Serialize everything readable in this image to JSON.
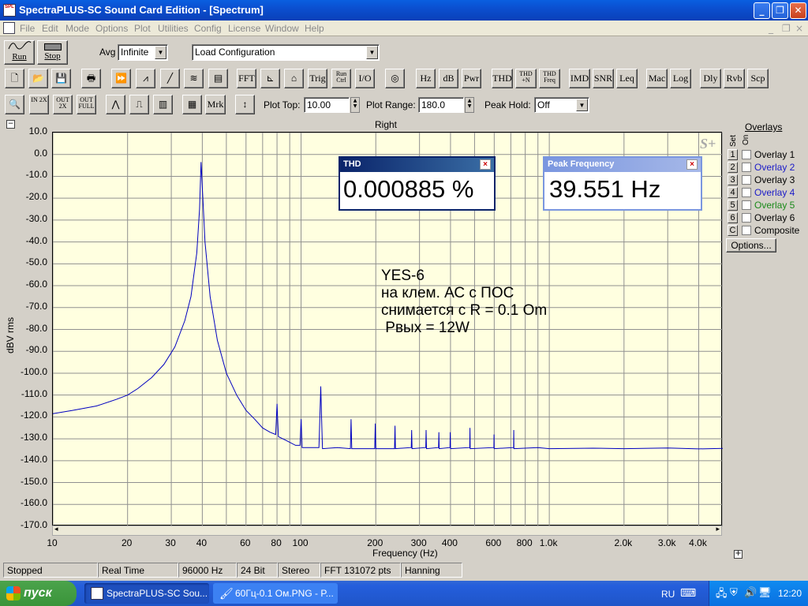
{
  "window": {
    "title": "SpectraPLUS-SC Sound Card Edition - [Spectrum]",
    "minimize": "_",
    "restore": "❐",
    "close": "✕"
  },
  "menu": [
    "File",
    "Edit",
    "Mode",
    "Options",
    "Plot",
    "Utilities",
    "Config",
    "License",
    "Window",
    "Help"
  ],
  "mdi_controls": {
    "minimize": "_",
    "restore": "❐",
    "close": "×"
  },
  "toolbar1": {
    "run": "Run",
    "stop": "Stop",
    "avg_label": "Avg",
    "avg_value": "Infinite",
    "config_value": "Load Configuration"
  },
  "toolbar2": [
    "FFT",
    "Trig",
    "Run Ctrl",
    "I/O",
    "Hz",
    "dB",
    "Pwr",
    "THD",
    "THD +N",
    "THD Freq",
    "IMD",
    "SNR",
    "Leq",
    "Mac",
    "Log",
    "Dly",
    "Rvb",
    "Scp"
  ],
  "toolbar3": {
    "zoom_in": "IN 2X",
    "zoom_out": "OUT 2X",
    "zoom_full": "OUT FULL",
    "mrk": "Mrk",
    "plot_top_label": "Plot Top:",
    "plot_top_value": "10.00",
    "plot_range_label": "Plot Range:",
    "plot_range_value": "180.0",
    "peak_hold_label": "Peak Hold:",
    "peak_hold_value": "Off"
  },
  "chart_data": {
    "type": "line",
    "title": "Right",
    "xlabel": "Frequency (Hz)",
    "ylabel": "dBV rms",
    "xscale": "log",
    "xlim": [
      10,
      5000
    ],
    "ylim": [
      -170,
      10
    ],
    "yticks": [
      "10.0",
      "0.0",
      "-10.0",
      "-20.0",
      "-30.0",
      "-40.0",
      "-50.0",
      "-60.0",
      "-70.0",
      "-80.0",
      "-90.0",
      "-100.0",
      "-110.0",
      "-120.0",
      "-130.0",
      "-140.0",
      "-150.0",
      "-160.0",
      "-170.0"
    ],
    "xticks": [
      "10",
      "20",
      "30",
      "40",
      "60",
      "80",
      "100",
      "200",
      "300",
      "400",
      "600",
      "800",
      "1.0k",
      "2.0k",
      "3.0k",
      "4.0k"
    ],
    "grid": true,
    "series": [
      {
        "color": "#0000c0",
        "points": [
          [
            10,
            -118.5
          ],
          [
            12,
            -117
          ],
          [
            15,
            -115
          ],
          [
            18,
            -112
          ],
          [
            20,
            -110
          ],
          [
            22,
            -107
          ],
          [
            25,
            -102
          ],
          [
            28,
            -96
          ],
          [
            31,
            -88
          ],
          [
            34,
            -76
          ],
          [
            36,
            -65
          ],
          [
            38,
            -45
          ],
          [
            39,
            -25
          ],
          [
            39.55,
            -3.5
          ],
          [
            40.2,
            -20
          ],
          [
            41,
            -40
          ],
          [
            43,
            -65
          ],
          [
            46,
            -85
          ],
          [
            50,
            -100
          ],
          [
            55,
            -110
          ],
          [
            60,
            -117
          ],
          [
            65,
            -121
          ],
          [
            70,
            -125
          ],
          [
            75,
            -127
          ],
          [
            79,
            -128
          ],
          [
            80,
            -114
          ],
          [
            81,
            -129
          ],
          [
            88,
            -131
          ],
          [
            95,
            -133
          ],
          [
            99,
            -133
          ],
          [
            100,
            -121
          ],
          [
            101,
            -134
          ],
          [
            110,
            -134
          ],
          [
            118,
            -134
          ],
          [
            119,
            -121
          ],
          [
            120,
            -106
          ],
          [
            121,
            -121
          ],
          [
            122,
            -134.5
          ],
          [
            140,
            -134
          ],
          [
            158,
            -134.5
          ],
          [
            159,
            -121
          ],
          [
            160,
            -134.5
          ],
          [
            198,
            -134.5
          ],
          [
            199,
            -123
          ],
          [
            200,
            -134.5
          ],
          [
            238,
            -134.5
          ],
          [
            239,
            -124
          ],
          [
            240,
            -134.5
          ],
          [
            278,
            -134
          ],
          [
            279,
            -126
          ],
          [
            280,
            -134.5
          ],
          [
            318,
            -134
          ],
          [
            319,
            -126
          ],
          [
            320,
            -134.5
          ],
          [
            358,
            -134
          ],
          [
            359,
            -127
          ],
          [
            360,
            -134.5
          ],
          [
            398,
            -134
          ],
          [
            399,
            -127
          ],
          [
            400,
            -134.5
          ],
          [
            478,
            -134
          ],
          [
            479,
            -125
          ],
          [
            480,
            -134.5
          ],
          [
            598,
            -134
          ],
          [
            599,
            -128
          ],
          [
            600,
            -134.5
          ],
          [
            718,
            -134
          ],
          [
            719,
            -126
          ],
          [
            720,
            -134.5
          ],
          [
            900,
            -134
          ],
          [
            1000,
            -134.5
          ],
          [
            1500,
            -134.3
          ],
          [
            2000,
            -134.5
          ],
          [
            3000,
            -134.2
          ],
          [
            4000,
            -134.6
          ],
          [
            5000,
            -134.4
          ]
        ]
      }
    ]
  },
  "thd_window": {
    "title": "THD",
    "value": "0.000885 %"
  },
  "peak_window": {
    "title": "Peak Frequency",
    "value": "39.551 Hz"
  },
  "annotation": [
    "YES-6",
    "на клем. АС с ПОС",
    "снимается с R = 0.1 Om",
    " Pвых = 12W"
  ],
  "overlays": {
    "header": "Overlays",
    "set_label": "Set",
    "on_label": "On",
    "items": [
      {
        "num": "1",
        "name": "Overlay 1",
        "color": "#000000"
      },
      {
        "num": "2",
        "name": "Overlay 2",
        "color": "#1a1ac8"
      },
      {
        "num": "3",
        "name": "Overlay 3",
        "color": "#000000"
      },
      {
        "num": "4",
        "name": "Overlay 4",
        "color": "#1a1ac8"
      },
      {
        "num": "5",
        "name": "Overlay 5",
        "color": "#1a8a1a"
      },
      {
        "num": "6",
        "name": "Overlay 6",
        "color": "#000000"
      },
      {
        "num": "C",
        "name": "Composite",
        "color": "#000000"
      }
    ],
    "options_label": "Options..."
  },
  "status": [
    "Stopped",
    "Real Time",
    "96000 Hz",
    "24 Bit",
    "Stereo",
    "FFT 131072 pts",
    "Hanning"
  ],
  "taskbar": {
    "start": "пуск",
    "tasks": [
      "SpectraPLUS-SC Sou...",
      "60Гц-0.1 Ом.PNG - P..."
    ],
    "lang": "RU",
    "clock": "12:20"
  }
}
